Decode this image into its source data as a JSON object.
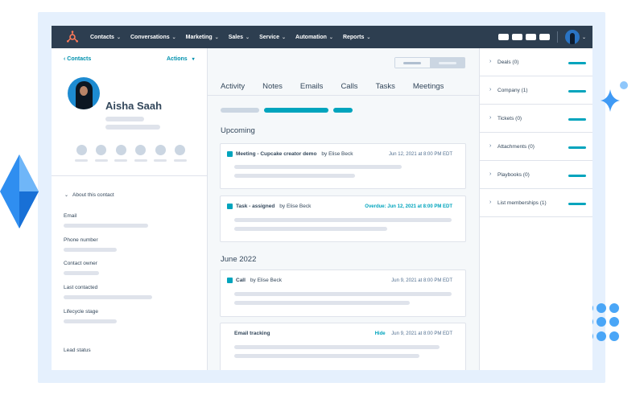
{
  "nav": {
    "items": [
      {
        "label": "Contacts"
      },
      {
        "label": "Conversations"
      },
      {
        "label": "Marketing"
      },
      {
        "label": "Sales"
      },
      {
        "label": "Service"
      },
      {
        "label": "Automation"
      },
      {
        "label": "Reports"
      }
    ]
  },
  "contact": {
    "back_label": "Contacts",
    "actions_label": "Actions",
    "name": "Aisha Saah",
    "about_label": "About this contact",
    "fields": [
      "Email",
      "Phone number",
      "Contact owner",
      "Last contacted",
      "Lifecycle stage",
      "Lead status"
    ]
  },
  "timeline": {
    "tabs": [
      "Activity",
      "Notes",
      "Emails",
      "Calls",
      "Tasks",
      "Meetings"
    ],
    "upcoming_label": "Upcoming",
    "june_label": "June 2022",
    "cards": [
      {
        "title": "Meeting - Cupcake creator demo",
        "by": "by Elise Beck",
        "date": "Jun 12, 2021 at 8:00 PM EDT"
      },
      {
        "title": "Task - assigned",
        "by": "by Elise Beck",
        "date_prefix": "Overdue:",
        "date": "Jun 12, 2021 at 8:00 PM EDT"
      },
      {
        "title": "Call",
        "by": "by Elise Beck",
        "date": "Jun 9, 2021 at 8:00 PM EDT"
      },
      {
        "title": "Email tracking",
        "hide_label": "Hide",
        "date": "Jun 9, 2021 at 8:00 PM EDT"
      }
    ]
  },
  "sidebar": {
    "items": [
      {
        "label": "Deals (0)"
      },
      {
        "label": "Company (1)"
      },
      {
        "label": "Tickets (0)"
      },
      {
        "label": "Attachments (0)"
      },
      {
        "label": "Playbooks (0)"
      },
      {
        "label": "List memberships (1)"
      }
    ]
  },
  "colors": {
    "nav_bg": "#2d3e50",
    "accent": "#00a4bd",
    "link": "#0091ae",
    "frame_bg": "#e5f0fd",
    "chat_bubble": "#7158e2"
  },
  "icons": {
    "logo": "sprocket-icon",
    "back": "chevron-left-icon",
    "actions": "chevron-down-icon",
    "about": "chevron-down-icon",
    "sidebar": "chevron-right-icon",
    "chat": "chat-bubble-icon"
  }
}
